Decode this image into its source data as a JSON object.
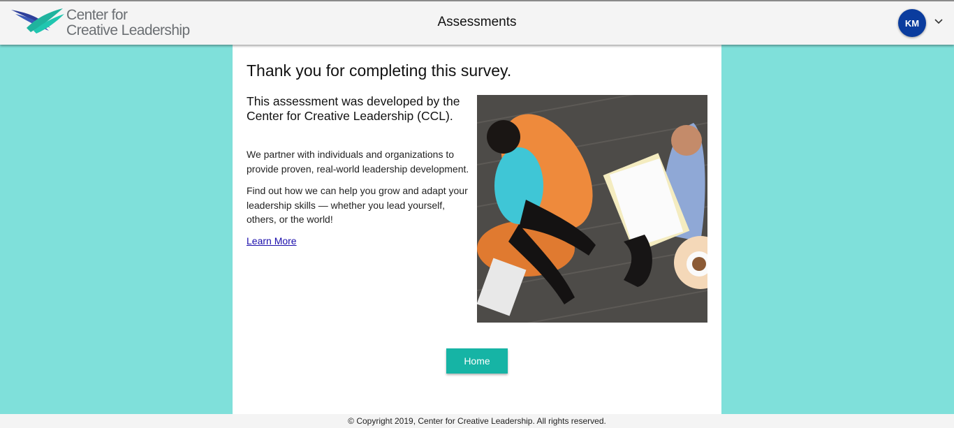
{
  "header": {
    "logo_line1": "Center for",
    "logo_line2": "Creative Leadership",
    "title": "Assessments",
    "user_initials": "KM"
  },
  "main": {
    "thanks_heading": "Thank you for completing this survey.",
    "developed_heading": "This assessment was developed by the Center for Creative Leadership (CCL).",
    "paragraph1": "We partner with individuals and organizations to provide proven, real-world leadership development.",
    "paragraph2": "Find out how we can help you grow and adapt your leadership skills — whether you lead yourself, others, or the world!",
    "learn_more_label": "Learn More",
    "home_button_label": "Home"
  },
  "footer": {
    "copyright": "© Copyright 2019, Center for Creative Leadership. All rights reserved."
  },
  "colors": {
    "background": "#7fe0da",
    "brand_teal": "#16b4a5",
    "avatar_blue": "#0a3c9e"
  },
  "icons": [
    "ccl-logo-icon",
    "chevron-down-icon"
  ]
}
